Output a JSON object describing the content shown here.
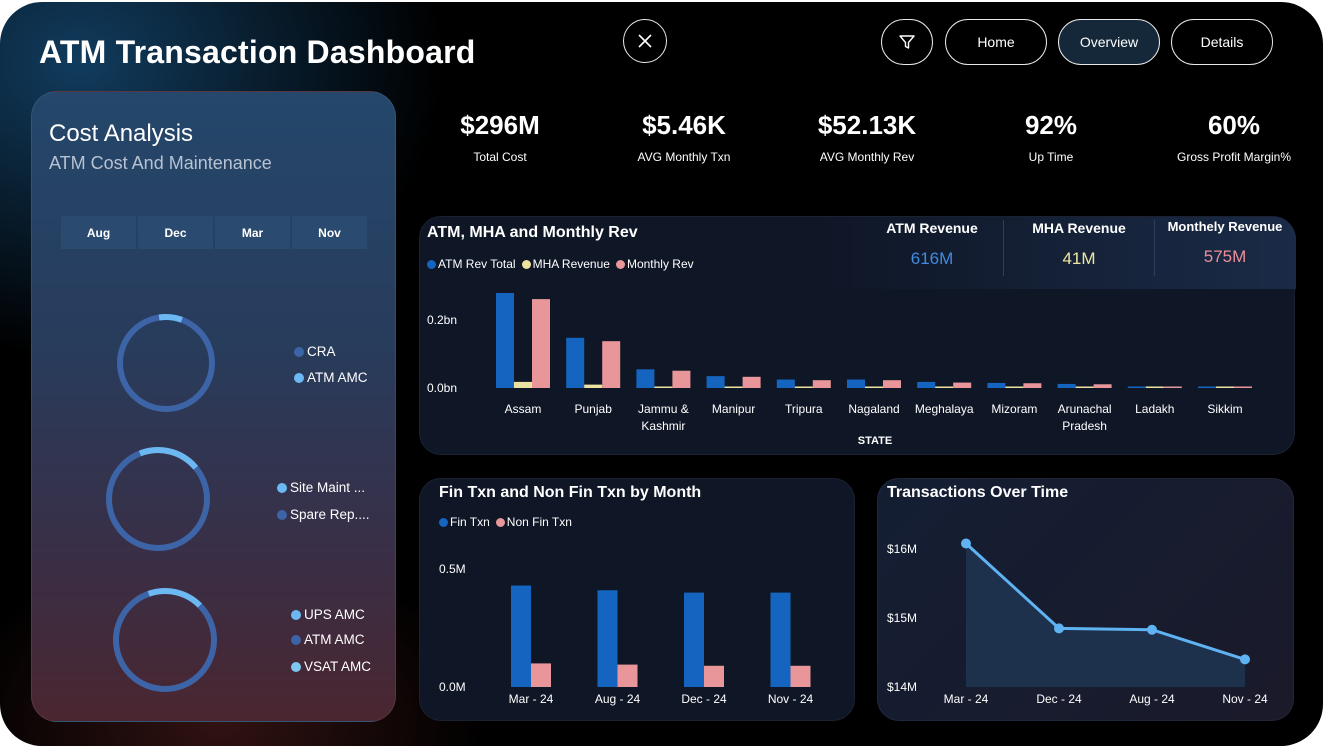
{
  "header": {
    "title": "ATM Transaction Dashboard",
    "nav": {
      "home": "Home",
      "overview": "Overview",
      "details": "Details"
    },
    "icons": {
      "close": "close-icon",
      "filter": "filter-icon"
    }
  },
  "cost_panel": {
    "title": "Cost Analysis",
    "subtitle": "ATM Cost And Maintenance",
    "months": [
      "Aug",
      "Dec",
      "Mar",
      "Nov"
    ],
    "donuts": [
      {
        "legend": [
          "CRA",
          "ATM AMC"
        ],
        "colors": [
          "#3d64a6",
          "#6cb8f2"
        ],
        "highlight_fraction": 0.08
      },
      {
        "legend": [
          "Site Maint ...",
          "Spare Rep...."
        ],
        "colors": [
          "#6cb8f2",
          "#3d64a6"
        ],
        "highlight_fraction": 0.2
      },
      {
        "legend": [
          "UPS AMC",
          "ATM AMC",
          "VSAT AMC"
        ],
        "colors": [
          "#6cb8f2",
          "#3d64a6",
          "#7ec8f0"
        ],
        "highlight_fraction": 0.18
      }
    ]
  },
  "kpis": [
    {
      "value": "$296M",
      "label": "Total Cost"
    },
    {
      "value": "$5.46K",
      "label": "AVG Monthly Txn"
    },
    {
      "value": "$52.13K",
      "label": "AVG Monthly Rev"
    },
    {
      "value": "92%",
      "label": "Up Time"
    },
    {
      "value": "60%",
      "label": "Gross Profit Margin%"
    }
  ],
  "revenue_chart": {
    "title": "ATM, MHA and Monthly Rev",
    "summary": [
      {
        "label": "ATM Revenue",
        "value": "616M",
        "color": "#3f8be0"
      },
      {
        "label": "MHA Revenue",
        "value": "41M",
        "color": "#efe6a2"
      },
      {
        "label": "Monthely Revenue",
        "value": "575M",
        "color": "#ee8f96"
      }
    ]
  },
  "fin_chart": {
    "title": "Fin Txn and Non Fin Txn by Month"
  },
  "time_chart": {
    "title": "Transactions Over Time"
  },
  "chart_data": [
    {
      "type": "bar",
      "title": "ATM, MHA and Monthly Rev",
      "xlabel": "STATE",
      "ylabel": "",
      "categories": [
        "Assam",
        "Punjab",
        "Jammu & Kashmir",
        "Manipur",
        "Tripura",
        "Nagaland",
        "Meghalaya",
        "Mizoram",
        "Arunachal Pradesh",
        "Ladakh",
        "Sikkim"
      ],
      "series": [
        {
          "name": "ATM Rev Total",
          "color": "#1565c0",
          "values": [
            0.28,
            0.148,
            0.055,
            0.035,
            0.025,
            0.025,
            0.018,
            0.015,
            0.012,
            0.003,
            0.003
          ]
        },
        {
          "name": "MHA Revenue",
          "color": "#ede3a0",
          "values": [
            0.018,
            0.01,
            0.004,
            0.003,
            0.002,
            0.002,
            0.002,
            0.001,
            0.001,
            0.0005,
            0.0005
          ]
        },
        {
          "name": "Monthly Rev",
          "color": "#e8969a",
          "values": [
            0.262,
            0.138,
            0.051,
            0.033,
            0.023,
            0.023,
            0.016,
            0.014,
            0.011,
            0.003,
            0.003
          ]
        }
      ],
      "ytick_labels": [
        "0.0bn",
        "0.2bn"
      ],
      "yticks": [
        0,
        0.2
      ],
      "ylim": [
        0,
        0.3
      ],
      "legend": "top-left"
    },
    {
      "type": "bar",
      "title": "Fin Txn and Non Fin Txn by Month",
      "categories": [
        "Mar - 24",
        "Aug - 24",
        "Dec - 24",
        "Nov - 24"
      ],
      "series": [
        {
          "name": "Fin Txn",
          "color": "#1565c0",
          "values": [
            0.43,
            0.41,
            0.4,
            0.4
          ]
        },
        {
          "name": "Non Fin Txn",
          "color": "#e8969a",
          "values": [
            0.1,
            0.095,
            0.09,
            0.09
          ]
        }
      ],
      "ytick_labels": [
        "0.0M",
        "0.5M"
      ],
      "yticks": [
        0,
        0.5
      ],
      "ylim": [
        0,
        0.55
      ],
      "legend": "top-left"
    },
    {
      "type": "area",
      "title": "Transactions Over Time",
      "x": [
        "Mar - 24",
        "Dec - 24",
        "Aug - 24",
        "Nov - 24"
      ],
      "y": [
        16.08,
        14.85,
        14.83,
        14.4
      ],
      "ytick_labels": [
        "$14M",
        "$15M",
        "$16M"
      ],
      "yticks": [
        14,
        15,
        16
      ],
      "ylim": [
        14,
        16.2
      ],
      "color": "#5fb3f2"
    }
  ]
}
